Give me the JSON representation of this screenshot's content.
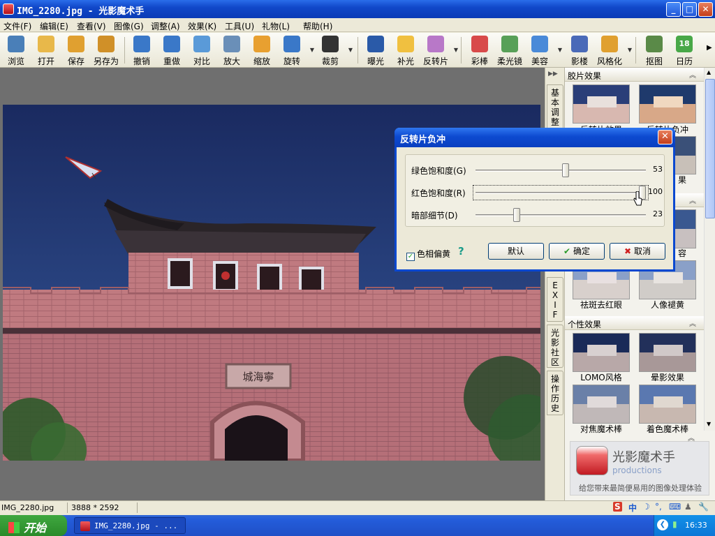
{
  "window": {
    "title": "IMG_2280.jpg - 光影魔术手",
    "min": "_",
    "max": "□",
    "close": "✕"
  },
  "menu": [
    "文件(F)",
    "编辑(E)",
    "查看(V)",
    "图像(G)",
    "调整(A)",
    "效果(K)",
    "工具(U)",
    "礼物(L)",
    "帮助(H)"
  ],
  "toolbar": [
    {
      "label": "浏览",
      "icon": "browse-icon",
      "color": "#4a7fb8"
    },
    {
      "label": "打开",
      "icon": "open-folder-icon",
      "color": "#e8b84a"
    },
    {
      "label": "保存",
      "icon": "save-icon",
      "color": "#e0a030"
    },
    {
      "label": "另存为",
      "icon": "save-as-icon",
      "color": "#d09028"
    },
    {
      "label": "撤销",
      "icon": "undo-icon",
      "color": "#3a78c8"
    },
    {
      "label": "重做",
      "icon": "redo-icon",
      "color": "#3a78c8"
    },
    {
      "label": "对比",
      "icon": "compare-icon",
      "color": "#5a9ad8"
    },
    {
      "label": "放大",
      "icon": "zoom-in-icon",
      "color": "#6a8fb8"
    },
    {
      "label": "缩放",
      "icon": "resize-icon",
      "color": "#e8a030"
    },
    {
      "label": "旋转",
      "icon": "rotate-icon",
      "color": "#3a78c8"
    },
    {
      "label": "裁剪",
      "icon": "crop-icon",
      "color": "#333333"
    },
    {
      "label": "曝光",
      "icon": "exposure-icon",
      "color": "#2a5aa8"
    },
    {
      "label": "补光",
      "icon": "fill-light-icon",
      "color": "#f0c040"
    },
    {
      "label": "反转片",
      "icon": "reversal-film-icon",
      "color": "#b878c8"
    },
    {
      "label": "彩棒",
      "icon": "color-wand-icon",
      "color": "#d84a4a"
    },
    {
      "label": "柔光镜",
      "icon": "soft-focus-icon",
      "color": "#58a058"
    },
    {
      "label": "美容",
      "icon": "beauty-icon",
      "color": "#4a8ad8"
    },
    {
      "label": "影楼",
      "icon": "studio-icon",
      "color": "#4a6ab8"
    },
    {
      "label": "风格化",
      "icon": "stylize-icon",
      "color": "#e0a030"
    },
    {
      "label": "抠图",
      "icon": "cutout-icon",
      "color": "#5a8a48"
    },
    {
      "label": "日历",
      "icon": "calendar-icon",
      "color": "#48a848",
      "text": "18"
    }
  ],
  "side_tabs": [
    "基本调整",
    "EXIF",
    "光影社区",
    "操作历史"
  ],
  "panel": {
    "sections": [
      {
        "title": "胶片效果",
        "up": "︽"
      },
      {
        "title": "个性效果",
        "up": "︽"
      }
    ],
    "film_thumbs": [
      "反转片效果",
      "反转片负冲"
    ],
    "partial_captions": [
      "果",
      "容"
    ],
    "portrait_thumbs": [
      "祛斑去红眼",
      "人像褪黄"
    ],
    "style_thumbs": [
      "LOMO风格",
      "晕影效果",
      "对焦魔术棒",
      "着色魔术棒"
    ]
  },
  "promo": {
    "name": "光影魔术手",
    "sub": "productions",
    "slogan": "给您带来最简便易用的图像处理体验"
  },
  "status": {
    "file": "IMG_2280.jpg",
    "size": "3888 * 2592"
  },
  "dialog": {
    "title": "反转片负冲",
    "close": "✕",
    "sliders": [
      {
        "label": "绿色饱和度(G)",
        "value": "53",
        "fraction": 0.53
      },
      {
        "label": "红色饱和度(R)",
        "value": "100",
        "fraction": 1.0
      },
      {
        "label": "暗部细节(D)",
        "value": "23",
        "fraction": 0.23
      }
    ],
    "checkbox_label": "色相偏黄",
    "checkbox_checked": true,
    "help": "?",
    "buttons": {
      "default": "默认",
      "ok": "确定",
      "cancel": "取消"
    }
  },
  "photo": {
    "sign": "城海寧"
  },
  "taskbar": {
    "start": "开始",
    "task": "IMG_2280.jpg - ...",
    "clock": "16:33"
  },
  "ime": [
    "S",
    "中",
    "☽",
    "°,",
    "⌨",
    "♟",
    "🔧"
  ],
  "colors": {
    "xp_blue": "#0a48d0",
    "sky": "#1d2e66",
    "wall": "#c27a80"
  }
}
